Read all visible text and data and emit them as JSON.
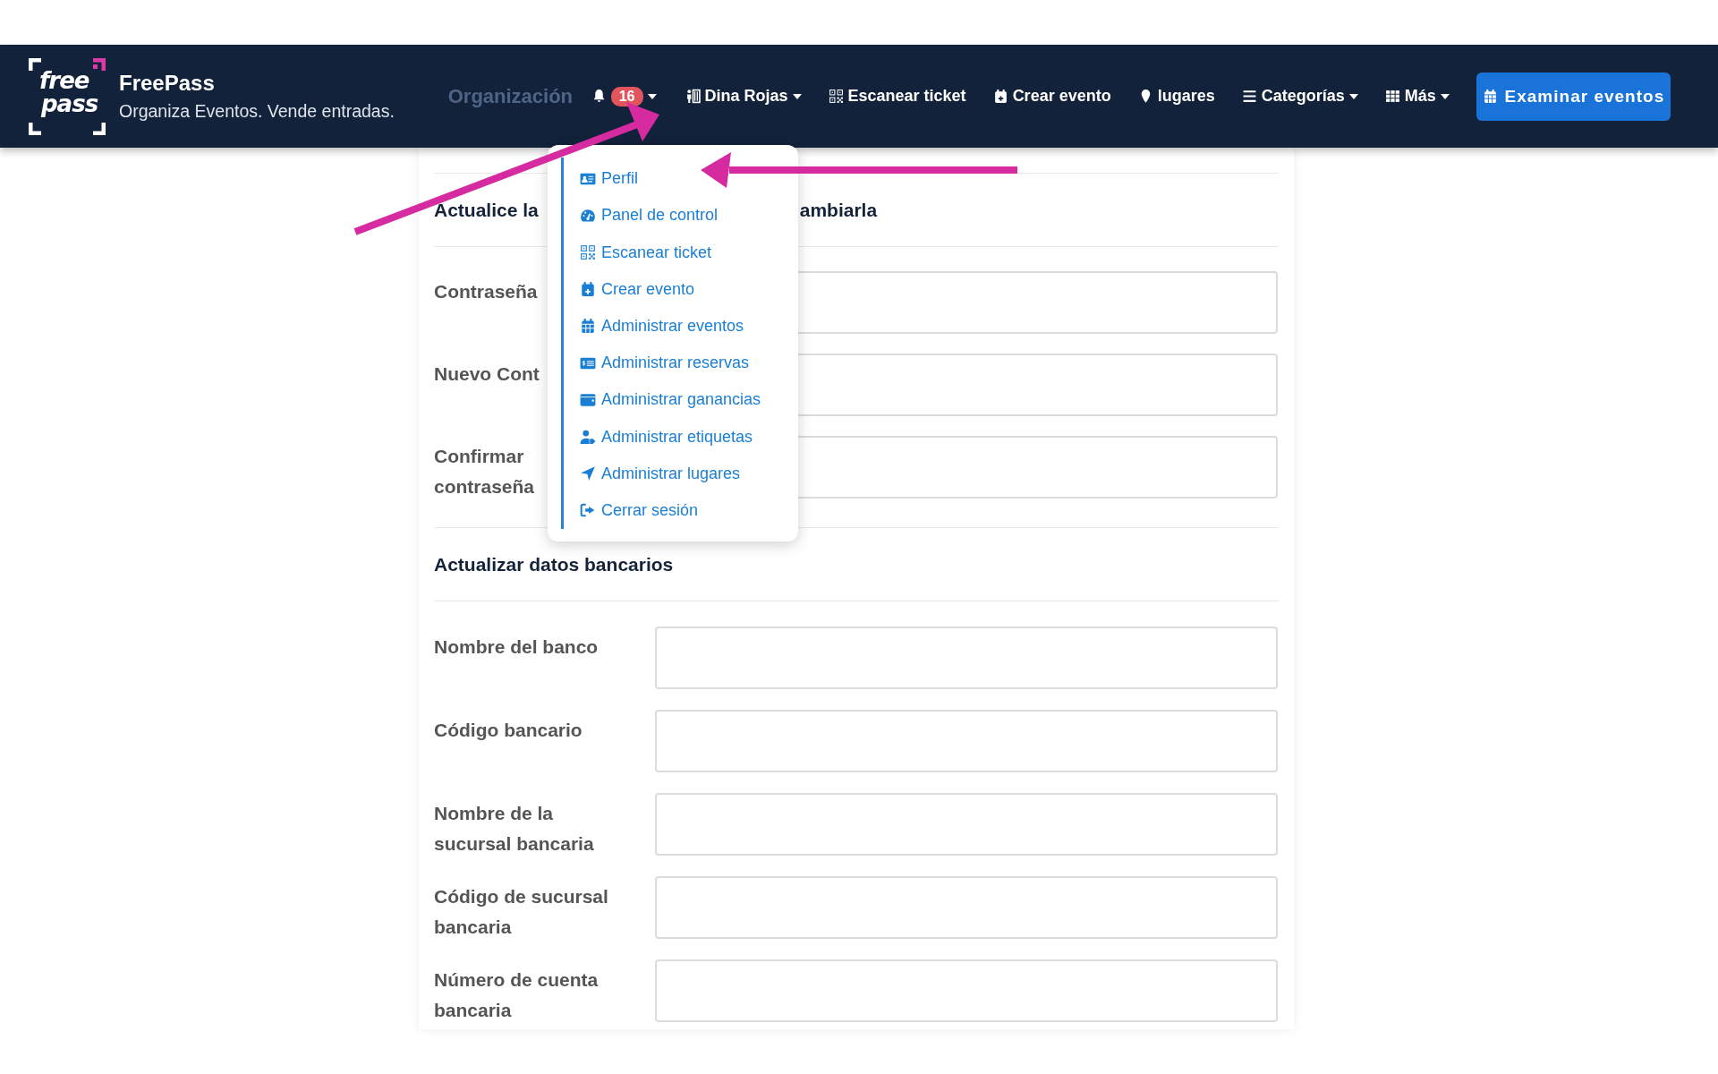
{
  "brand": {
    "logo_text": [
      "free",
      "pass"
    ],
    "name": "FreePass",
    "tagline": "Organiza Eventos. Vende entradas."
  },
  "nav": {
    "faded_label": "Organización",
    "notifications": {
      "count": "16",
      "has_menu": true
    },
    "items": [
      {
        "label": "Dina Rojas",
        "has_menu": true
      },
      {
        "label": "Escanear ticket",
        "has_menu": false
      },
      {
        "label": "Crear evento",
        "has_menu": false
      },
      {
        "label": "lugares",
        "has_menu": false
      },
      {
        "label": "Categorías",
        "has_menu": true
      },
      {
        "label": "Más",
        "has_menu": true
      }
    ],
    "cta": {
      "label": "Examinar eventos"
    }
  },
  "user_menu": {
    "items": [
      {
        "label": "Perfil"
      },
      {
        "label": "Panel de control"
      },
      {
        "label": "Escanear ticket"
      },
      {
        "label": "Crear evento"
      },
      {
        "label": "Administrar eventos"
      },
      {
        "label": "Administrar reservas"
      },
      {
        "label": "Administrar ganancias"
      },
      {
        "label": "Administrar etiquetas"
      },
      {
        "label": "Administrar lugares"
      },
      {
        "label": "Cerrar sesión"
      }
    ]
  },
  "password_section": {
    "heading_parts": [
      "Actualice la",
      "ambiarla"
    ],
    "fields": [
      {
        "label": "Contraseña"
      },
      {
        "label": "Nuevo Cont"
      },
      {
        "label": "Confirmar contraseña"
      }
    ]
  },
  "bank_section": {
    "heading": "Actualizar datos bancarios",
    "fields": [
      {
        "label": "Nombre del banco"
      },
      {
        "label": "Código bancario"
      },
      {
        "label": "Nombre de la sucursal bancaria"
      },
      {
        "label": "Código de sucursal bancaria"
      },
      {
        "label": "Número de cuenta bancaria"
      }
    ]
  }
}
